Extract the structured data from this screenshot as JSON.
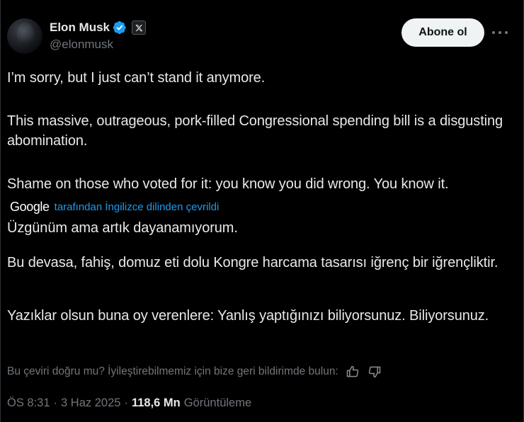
{
  "author": {
    "display_name": "Elon Musk",
    "handle": "@elonmusk",
    "verified_icon": "verified-badge-icon",
    "affiliation_icon": "x-logo-icon"
  },
  "actions": {
    "follow_label": "Abone ol",
    "more_icon": "more-horizontal-icon"
  },
  "original": {
    "line1": "I’m sorry, but I just can’t stand it anymore.",
    "line2": "This massive, outrageous, pork-filled Congressional spending bill is a disgusting abomination.",
    "line3": "Shame on those who voted for it: you know you did wrong. You know it."
  },
  "translation": {
    "provider": "Google",
    "credit": "tarafından İngilizce dilinden çevrildi",
    "line1": "Üzgünüm ama artık dayanamıyorum.",
    "line2": "Bu devasa, fahiş, domuz eti dolu Kongre harcama tasarısı iğrenç bir iğrençliktir.",
    "line3": "Yazıklar olsun buna oy verenlere: Yanlış yaptığınızı biliyorsunuz. Biliyorsunuz."
  },
  "feedback": {
    "question": "Bu çeviri doğru mu? İyileştirebilmemiz için bize geri bildirimde bulun:",
    "like_icon": "thumbs-up-icon",
    "dislike_icon": "thumbs-down-icon"
  },
  "meta": {
    "time": "ÖS 8:31",
    "separator": "·",
    "date": "3 Haz 2025",
    "views_count": "118,6 Mn",
    "views_label": "Görüntüleme"
  },
  "colors": {
    "background": "#000000",
    "text_primary": "#e7e9ea",
    "text_secondary": "#71767b",
    "accent": "#1d9bf0",
    "follow_bg": "#eff3f4"
  }
}
